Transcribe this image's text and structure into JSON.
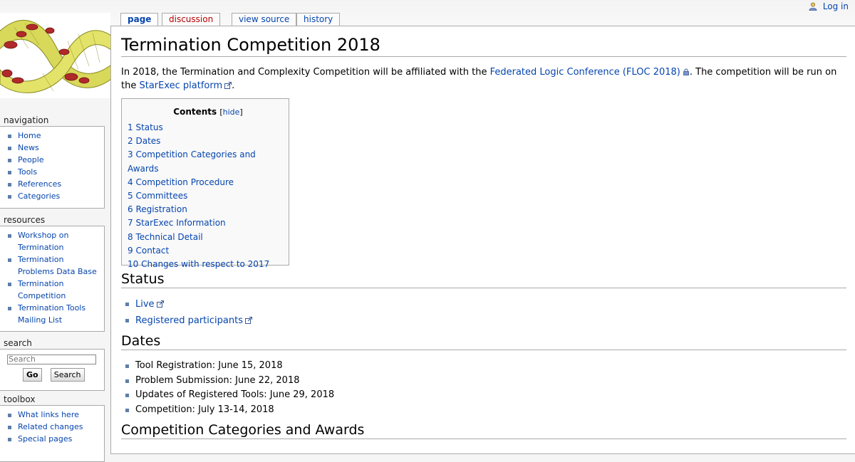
{
  "tabs": [
    {
      "label": "page"
    },
    {
      "label": "discussion"
    },
    {
      "label": "view source"
    },
    {
      "label": "history"
    }
  ],
  "personal": {
    "login": "Log in"
  },
  "sidebar": {
    "navigation": {
      "title": "navigation",
      "items": [
        {
          "label": "Home"
        },
        {
          "label": "News"
        },
        {
          "label": "People"
        },
        {
          "label": "Tools"
        },
        {
          "label": "References"
        },
        {
          "label": "Categories"
        }
      ]
    },
    "resources": {
      "title": "resources",
      "items": [
        {
          "label": "Workshop on Termination"
        },
        {
          "label": "Termination Problems Data Base"
        },
        {
          "label": "Termination Competition"
        },
        {
          "label": "Termination Tools Mailing List"
        }
      ]
    },
    "search": {
      "title": "search",
      "placeholder": "Search",
      "go": "Go",
      "search": "Search"
    },
    "toolbox": {
      "title": "toolbox",
      "items": [
        {
          "label": "What links here"
        },
        {
          "label": "Related changes"
        },
        {
          "label": "Special pages"
        }
      ]
    }
  },
  "page": {
    "title": "Termination Competition 2018",
    "intro": {
      "text1": "In 2018, the Termination and Complexity Competition will be affiliated with the ",
      "link1": "Federated Logic Conference (FLOC 2018)",
      "text2": ". The competition will be run on the ",
      "link2": "StarExec platform",
      "text3": "."
    },
    "toc": {
      "title": "Contents",
      "hide": "hide",
      "items": [
        {
          "num": "1",
          "label": "Status"
        },
        {
          "num": "2",
          "label": "Dates"
        },
        {
          "num": "3",
          "label": "Competition Categories and Awards"
        },
        {
          "num": "4",
          "label": "Competition Procedure"
        },
        {
          "num": "5",
          "label": "Committees"
        },
        {
          "num": "6",
          "label": "Registration"
        },
        {
          "num": "7",
          "label": "StarExec Information"
        },
        {
          "num": "8",
          "label": "Technical Detail"
        },
        {
          "num": "9",
          "label": "Contact"
        },
        {
          "num": "10",
          "label": "Changes with respect to 2017"
        }
      ]
    },
    "status": {
      "heading": "Status",
      "items": [
        {
          "label": "Live"
        },
        {
          "label": "Registered participants"
        }
      ]
    },
    "dates": {
      "heading": "Dates",
      "items": [
        {
          "label": "Tool Registration: June 15, 2018"
        },
        {
          "label": "Problem Submission: June 22, 2018"
        },
        {
          "label": "Updates of Registered Tools: June 29, 2018"
        },
        {
          "label": "Competition: July 13-14, 2018"
        }
      ]
    },
    "categories": {
      "heading": "Competition Categories and Awards"
    }
  },
  "colors": {
    "link": "#0645ad",
    "new_link": "#ba0000",
    "bullet": "#5e7ea8",
    "border": "#aaaaaa"
  }
}
